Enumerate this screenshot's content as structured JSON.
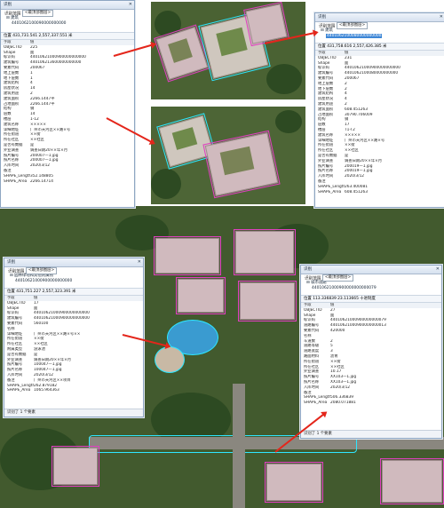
{
  "colors": {
    "highlight_magenta": "#e040c0",
    "highlight_cyan": "#2ee6ff",
    "arrow_red": "#e4261b",
    "selection_blue": "#3d86d6"
  },
  "panel_tl": {
    "title": "识别",
    "layer_label": "识别范围",
    "layer_value": "<最顶部图层>",
    "tree_root": "建筑",
    "tree_child": "4401062100090000000000",
    "position_label": "位置",
    "position_value": "431,731.541  2,557,337.551 米",
    "fields": [
      {
        "k": "字段",
        "v": "值"
      },
      {
        "k": "OBJECTID",
        "v": "225"
      },
      {
        "k": "Shape",
        "v": "面"
      },
      {
        "k": "标识码",
        "v": "44010621000900000000000"
      },
      {
        "k": "建筑编号",
        "v": "440106213600000000000"
      },
      {
        "k": "要素代码",
        "v": "200067"
      },
      {
        "k": "地上层数",
        "v": "1"
      },
      {
        "k": "地下层数",
        "v": "1"
      },
      {
        "k": "建筑结构",
        "v": "4"
      },
      {
        "k": "房屋状况",
        "v": "14"
      },
      {
        "k": "建筑用途",
        "v": "2"
      },
      {
        "k": "建筑面积",
        "v": "2266.1447平"
      },
      {
        "k": "占地面积",
        "v": "2266.1447平"
      },
      {
        "k": "结构",
        "v": "钢"
      },
      {
        "k": "层数",
        "v": "14"
      },
      {
        "k": "楼层",
        "v": "1-12"
      },
      {
        "k": "建筑名称",
        "v": "×××××"
      },
      {
        "k": "详细地址",
        "v": "广州市天河区××路×号"
      },
      {
        "k": "所在街道",
        "v": "××街"
      },
      {
        "k": "所在社区",
        "v": "××社区"
      },
      {
        "k": "是否有数据",
        "v": "是"
      },
      {
        "k": "外业调查",
        "v": "调查日期20××年×月"
      },
      {
        "k": "照片编号",
        "v": "200007—1.jpg"
      },
      {
        "k": "照片名称",
        "v": "200007—1.jpg"
      },
      {
        "k": "入库时间",
        "v": "2020/3/12"
      },
      {
        "k": "备注",
        "v": ""
      },
      {
        "k": "SHAPE_Length",
        "v": "352.148805"
      },
      {
        "k": "SHAPE_Area",
        "v": "2266.14714"
      }
    ]
  },
  "panel_tr": {
    "title": "识别",
    "layer_label": "识别范围",
    "layer_value": "<最顶部图层>",
    "tree_root": "建筑",
    "tree_child": "4401062100080000000000",
    "position_label": "位置",
    "position_value": "431,758.616  2,557,426.385 米",
    "fields": [
      {
        "k": "字段",
        "v": "值"
      },
      {
        "k": "OBJECTID",
        "v": "231"
      },
      {
        "k": "Shape",
        "v": "面"
      },
      {
        "k": "标识码",
        "v": "44010621000900000000000"
      },
      {
        "k": "建筑编号",
        "v": "4401062100080000000000"
      },
      {
        "k": "要素代码",
        "v": "200067"
      },
      {
        "k": "地上层数",
        "v": "2"
      },
      {
        "k": "地下层数",
        "v": "2"
      },
      {
        "k": "建筑结构",
        "v": "4"
      },
      {
        "k": "房屋状况",
        "v": "4"
      },
      {
        "k": "建筑用途",
        "v": "2"
      },
      {
        "k": "建筑面积",
        "v": "608.451263"
      },
      {
        "k": "占地面积",
        "v": "30790.706009"
      },
      {
        "k": "结构",
        "v": "钢"
      },
      {
        "k": "层数",
        "v": "17"
      },
      {
        "k": "楼层",
        "v": "T1-T2"
      },
      {
        "k": "建筑名称",
        "v": "×××××"
      },
      {
        "k": "详细地址",
        "v": "广州市天河区××路×号"
      },
      {
        "k": "所在街道",
        "v": "××街"
      },
      {
        "k": "所在社区",
        "v": "××社区"
      },
      {
        "k": "是否有数据",
        "v": "是"
      },
      {
        "k": "外业调查",
        "v": "调查日期20××年×月"
      },
      {
        "k": "照片编号",
        "v": "200019—1.jpg"
      },
      {
        "k": "照片名称",
        "v": "200019—1.jpg"
      },
      {
        "k": "入库时间",
        "v": "2020/3/12"
      },
      {
        "k": "备注",
        "v": ""
      },
      {
        "k": "SHAPE_Length",
        "v": "263.400081"
      },
      {
        "k": "SHAPE_Area",
        "v": "608.451263"
      }
    ]
  },
  "panel_bl": {
    "title": "识别",
    "layer_label": "识别范围",
    "layer_value": "<最顶部图层>",
    "tree_root": "园林绿地和其他附属物",
    "tree_child": "44010621000900000000000",
    "position_label": "位置",
    "position_value": "431,751.227  2,557,323.391 米",
    "fields": [
      {
        "k": "字段",
        "v": "值"
      },
      {
        "k": "OBJECTID",
        "v": "17"
      },
      {
        "k": "Shape",
        "v": "面"
      },
      {
        "k": "标识码",
        "v": "44010621000900000000000"
      },
      {
        "k": "建筑编号",
        "v": "44010621000900000000000"
      },
      {
        "k": "要素代码",
        "v": "560100"
      },
      {
        "k": "名称",
        "v": ""
      },
      {
        "k": "详细地址",
        "v": "广州市天河区××路×号××"
      },
      {
        "k": "所在街道",
        "v": "××街"
      },
      {
        "k": "所在社区",
        "v": "××社区"
      },
      {
        "k": "附属类型",
        "v": "游泳池"
      },
      {
        "k": "是否有数据",
        "v": "是"
      },
      {
        "k": "外业调查",
        "v": "调查日期20××年×月"
      },
      {
        "k": "照片编号",
        "v": "100047—1.jpg"
      },
      {
        "k": "照片名称",
        "v": "100047—1.jpg"
      },
      {
        "k": "入库时间",
        "v": "2020/3/12"
      },
      {
        "k": "备注",
        "v": "广州市天河区××项目"
      },
      {
        "k": "SHAPE_Length",
        "v": "262.879182"
      },
      {
        "k": "SHAPE_Area",
        "v": "1065.964363"
      }
    ],
    "status": "识别了 1 个要素"
  },
  "panel_br": {
    "title": "识别",
    "layer_label": "识别范围",
    "layer_value": "<最顶部图层>",
    "tree_root": "城市道路",
    "tree_child": "44010621000900000000000079",
    "position_label": "位置",
    "position_value": "113.336839  23.113665 十进制度",
    "fields": [
      {
        "k": "字段",
        "v": "值"
      },
      {
        "k": "OBJECTID",
        "v": "27"
      },
      {
        "k": "Shape",
        "v": "面"
      },
      {
        "k": "标识码",
        "v": "44010621000900000000079"
      },
      {
        "k": "道路编号",
        "v": "44010621000900000000013"
      },
      {
        "k": "要素代码",
        "v": "420000"
      },
      {
        "k": "名称",
        "v": ""
      },
      {
        "k": "车道数",
        "v": "2"
      },
      {
        "k": "道路等级",
        "v": "5"
      },
      {
        "k": "道路宽度",
        "v": "3"
      },
      {
        "k": "路面材料",
        "v": "沥青"
      },
      {
        "k": "所在街道",
        "v": "××街"
      },
      {
        "k": "所在社区",
        "v": "××社区"
      },
      {
        "k": "外业调查",
        "v": "10.17"
      },
      {
        "k": "照片编号",
        "v": "XX103—1.jpg"
      },
      {
        "k": "照片名称",
        "v": "XX103—1.jpg"
      },
      {
        "k": "入库时间",
        "v": "2020/3/12"
      },
      {
        "k": "备注",
        "v": ""
      },
      {
        "k": "SHAPE_Length",
        "v": "506.336839"
      },
      {
        "k": "SHAPE_Area",
        "v": "2080.071881"
      }
    ],
    "status": "识别了 1 个要素"
  }
}
